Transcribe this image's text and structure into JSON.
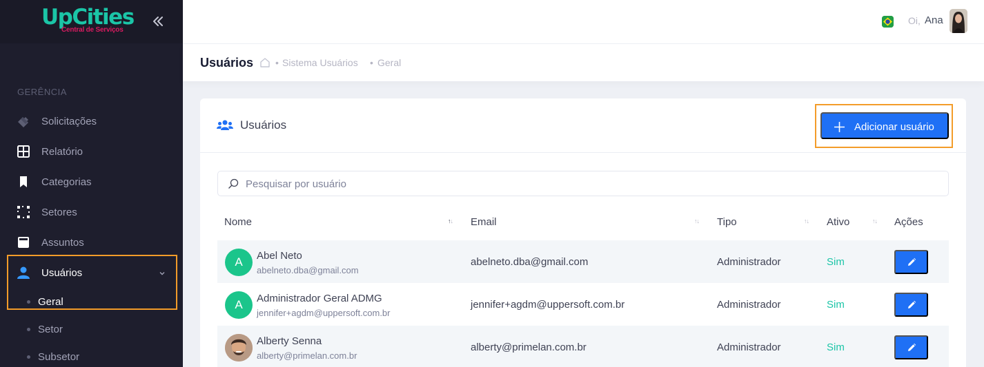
{
  "app": {
    "logo_main": "UpCities",
    "logo_sub": "Central de Serviços"
  },
  "sidebar": {
    "section": "GERÊNCIA",
    "items": [
      {
        "label": "Solicitações",
        "icon": "ticket-icon"
      },
      {
        "label": "Relatório",
        "icon": "grid-icon"
      },
      {
        "label": "Categorias",
        "icon": "bookmark-icon"
      },
      {
        "label": "Setores",
        "icon": "dotted-square-icon"
      },
      {
        "label": "Assuntos",
        "icon": "note-icon"
      },
      {
        "label": "Usuários",
        "icon": "user-icon",
        "active": true
      }
    ],
    "subitems": [
      {
        "label": "Geral",
        "active": true
      },
      {
        "label": "Setor"
      },
      {
        "label": "Subsetor"
      }
    ]
  },
  "header": {
    "greeting": "Oi,",
    "user_name": "Ana",
    "language_flag": "brazil-flag-icon"
  },
  "subheader": {
    "title": "Usuários",
    "breadcrumb": [
      "Sistema Usuários",
      "Geral"
    ]
  },
  "card": {
    "title": "Usuários",
    "add_button": "Adicionar usuário",
    "search_placeholder": "Pesquisar por usuário"
  },
  "table": {
    "columns": [
      "Nome",
      "Email",
      "Tipo",
      "Ativo",
      "Ações"
    ],
    "sorted_column": "Nome",
    "sort_direction": "asc",
    "rows": [
      {
        "initial": "A",
        "name": "Abel Neto",
        "email_sub": "abelneto.dba@gmail.com",
        "email": "abelneto.dba@gmail.com",
        "type": "Administrador",
        "active": "Sim"
      },
      {
        "initial": "A",
        "name": "Administrador Geral ADMG",
        "email_sub": "jennifer+agdm@uppersoft.com.br",
        "email": "jennifer+agdm@uppersoft.com.br",
        "type": "Administrador",
        "active": "Sim"
      },
      {
        "initial": "",
        "name": "Alberty Senna",
        "email_sub": "alberty@primelan.com.br",
        "email": "alberty@primelan.com.br",
        "type": "Administrador",
        "active": "Sim"
      }
    ]
  },
  "colors": {
    "sidebar_bg": "#1e1e2d",
    "primary": "#1f70f5",
    "success": "#1bc5a7",
    "highlight": "#f39c29"
  }
}
